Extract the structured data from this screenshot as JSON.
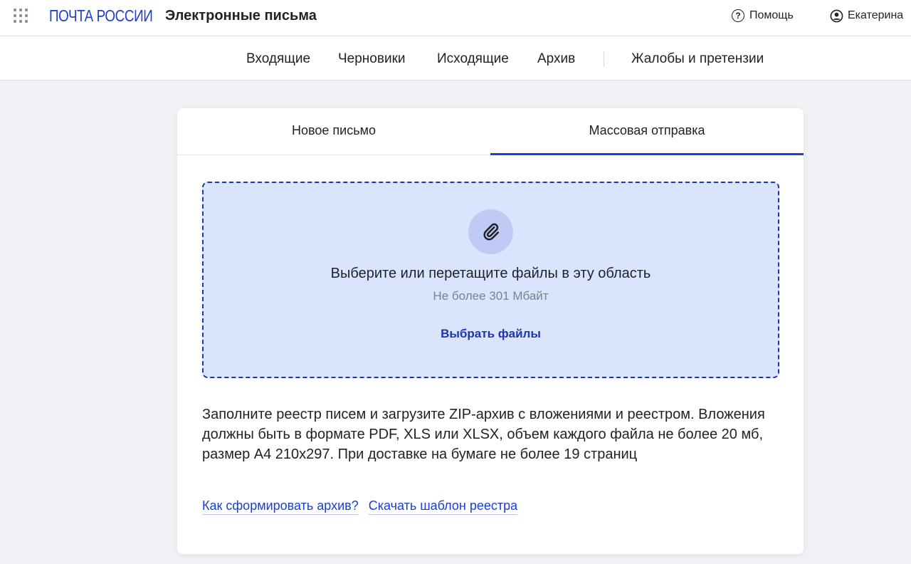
{
  "header": {
    "logo_text": "ПОЧТА РОССИИ",
    "app_title": "Электронные письма",
    "help_label": "Помощь",
    "user_name": "Екатерина"
  },
  "subnav": {
    "items": [
      {
        "label": "Входящие"
      },
      {
        "label": "Черновики"
      },
      {
        "label": "Исходящие"
      },
      {
        "label": "Архив"
      },
      {
        "label": "Жалобы и претензии"
      }
    ]
  },
  "tabs": [
    {
      "label": "Новое письмо",
      "active": false
    },
    {
      "label": "Массовая отправка",
      "active": true
    }
  ],
  "dropzone": {
    "title": "Выберите или перетащите файлы в эту область",
    "size_limit": "Не более 301 Мбайт",
    "button_label": "Выбрать файлы"
  },
  "description": "Заполните реестр писем и загрузите ZIP-архив с вложениями и реестром. Вложения должны быть в формате PDF, XLS или XLSX, объем каждого файла не более 20 мб, размер А4 210х297. При доставке на бумаге не более 19 страниц",
  "links": {
    "how_to_archive": "Как сформировать архив?",
    "download_template": "Скачать шаблон реестра"
  },
  "colors": {
    "accent": "#1b3fd1",
    "dropzone_bg": "#dbe4fd",
    "page_bg": "#f1f2f6"
  },
  "icons": [
    "apps-grid-icon",
    "help-circle-icon",
    "user-circle-icon",
    "paperclip-icon"
  ]
}
